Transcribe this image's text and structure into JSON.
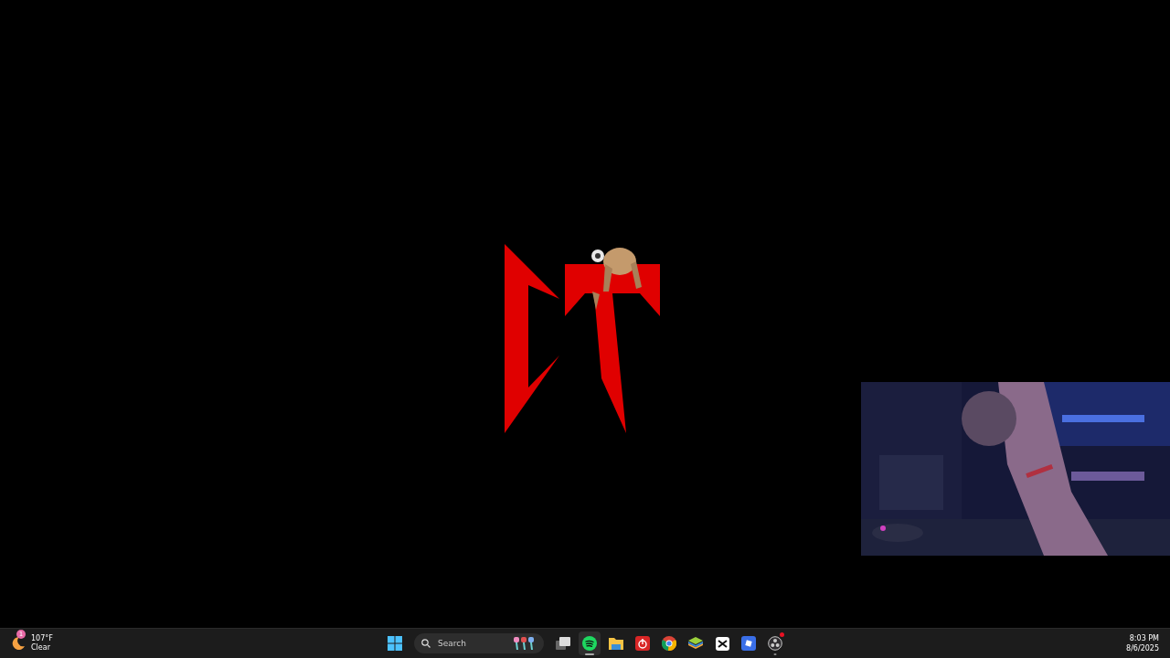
{
  "desktop": {
    "wallpaper": {
      "kind": "logo"
    }
  },
  "taskbar": {
    "weather": {
      "badge": "1",
      "temperature": "107°F",
      "condition": "Clear"
    },
    "search": {
      "placeholder": "Search"
    },
    "apps": [
      {
        "kind": "start",
        "selected": false,
        "running": false,
        "notification": false
      },
      {
        "kind": "taskview",
        "selected": false,
        "running": false,
        "notification": false
      },
      {
        "kind": "music",
        "selected": true,
        "running": true,
        "notification": false
      },
      {
        "kind": "folder",
        "selected": false,
        "running": false,
        "notification": false
      },
      {
        "kind": "redapp",
        "selected": false,
        "running": false,
        "notification": false
      },
      {
        "kind": "browser",
        "selected": false,
        "running": false,
        "notification": false
      },
      {
        "kind": "layers",
        "selected": false,
        "running": false,
        "notification": false
      },
      {
        "kind": "editor",
        "selected": false,
        "running": false,
        "notification": false
      },
      {
        "kind": "square",
        "selected": false,
        "running": false,
        "notification": false
      },
      {
        "kind": "recorder",
        "selected": false,
        "running": true,
        "notification": true
      }
    ],
    "clock": {
      "time": "8:03 PM",
      "date": "8/6/2025"
    }
  }
}
